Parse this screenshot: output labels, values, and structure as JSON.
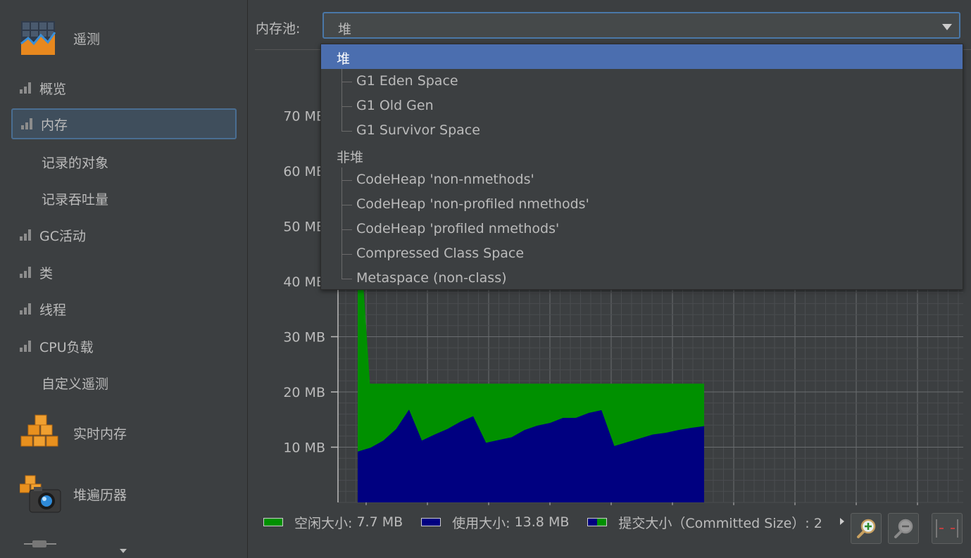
{
  "sidebar": {
    "telemetry": "遥测",
    "items": [
      {
        "label": "概览",
        "icon": "bars-icon"
      },
      {
        "label": "内存",
        "icon": "bars-icon",
        "selected": true
      },
      {
        "label": "记录的对象",
        "icon": ""
      },
      {
        "label": "记录吞吐量",
        "icon": ""
      },
      {
        "label": "GC活动",
        "icon": "bars-icon"
      },
      {
        "label": "类",
        "icon": "bars-icon"
      },
      {
        "label": "线程",
        "icon": "bars-icon"
      },
      {
        "label": "CPU负载",
        "icon": "bars-icon"
      },
      {
        "label": "自定义遥测",
        "icon": ""
      }
    ],
    "live_memory": "实时内存",
    "heap_walker": "堆遍历器"
  },
  "pool": {
    "label": "内存池:",
    "selected": "堆",
    "options": [
      {
        "label": "堆",
        "kind": "group",
        "selected": true
      },
      {
        "label": "G1 Eden Space",
        "kind": "child"
      },
      {
        "label": "G1 Old Gen",
        "kind": "child"
      },
      {
        "label": "G1 Survivor Space",
        "kind": "child"
      },
      {
        "label": "非堆",
        "kind": "group"
      },
      {
        "label": "CodeHeap 'non-nmethods'",
        "kind": "child"
      },
      {
        "label": "CodeHeap 'non-profiled nmethods'",
        "kind": "child"
      },
      {
        "label": "CodeHeap 'profiled nmethods'",
        "kind": "child"
      },
      {
        "label": "Compressed Class Space",
        "kind": "child"
      },
      {
        "label": "Metaspace (non-class)",
        "kind": "child"
      }
    ]
  },
  "chart_data": {
    "type": "area",
    "yticks": [
      "10 MB",
      "20 MB",
      "30 MB",
      "40 MB",
      "50 MB",
      "60 MB",
      "70 MB"
    ],
    "ylim": [
      0,
      70
    ],
    "grid": true,
    "series": [
      {
        "name": "使用大小",
        "color": "#000080",
        "x": [
          0,
          1,
          2,
          3,
          4,
          5,
          6,
          7,
          8,
          9,
          10,
          11,
          12,
          13,
          14,
          15,
          16,
          17,
          18,
          19,
          20,
          21,
          22,
          23,
          24,
          25,
          26,
          27
        ],
        "values": [
          9.2,
          9.9,
          11.2,
          13.3,
          16.8,
          11.2,
          12.3,
          13.3,
          14.6,
          15.6,
          10.8,
          11.3,
          11.8,
          13.1,
          13.9,
          14.4,
          15.3,
          15.3,
          16.2,
          16.7,
          10.2,
          10.9,
          11.6,
          12.3,
          12.6,
          13.1,
          13.5,
          13.8
        ]
      },
      {
        "name": "空闲大小",
        "color": "#009000",
        "x": [
          0,
          0.95,
          27
        ],
        "values": [
          55,
          21.5,
          21.5
        ]
      }
    ],
    "legend": [
      {
        "label": "空闲大小:",
        "value": "7.7 MB",
        "color": "#009000"
      },
      {
        "label": "使用大小:",
        "value": "13.8 MB",
        "color": "#000080"
      },
      {
        "label": "提交大小（Committed Size）: 2",
        "value": "",
        "color": [
          "#000080",
          "#009000"
        ]
      }
    ]
  }
}
